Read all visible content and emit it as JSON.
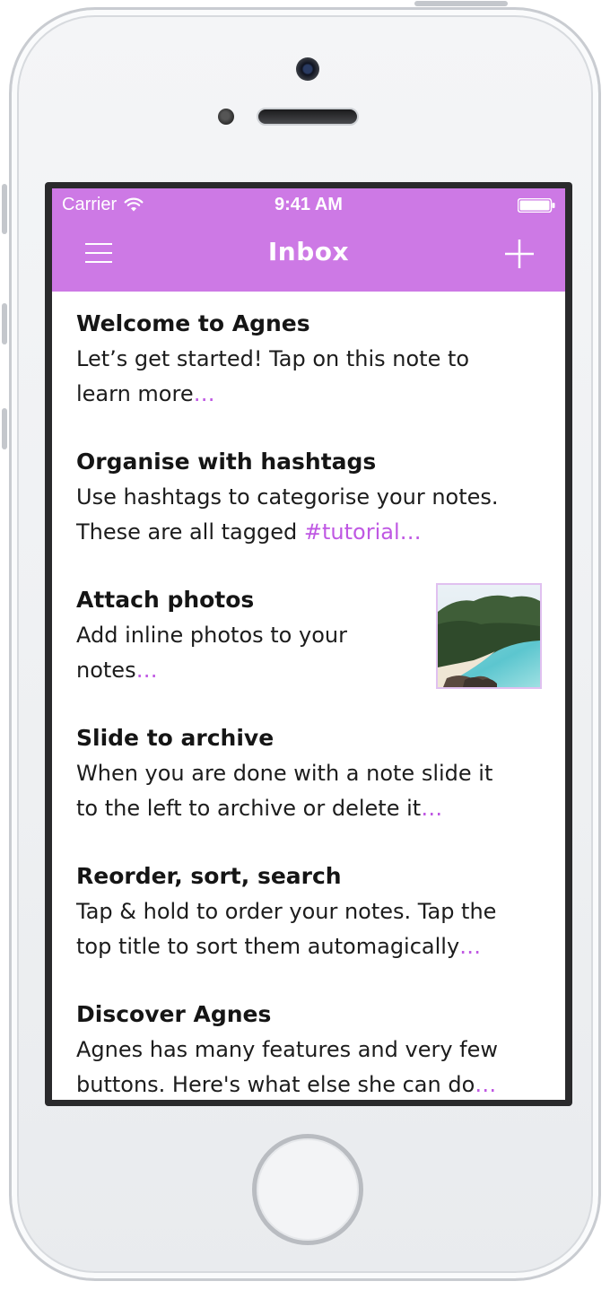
{
  "status_bar": {
    "carrier": "Carrier",
    "time": "9:41 AM"
  },
  "nav": {
    "title": "Inbox"
  },
  "colors": {
    "accent": "#cd79e5",
    "link": "#bf58e3",
    "text": "#1c1c1c"
  },
  "notes": [
    {
      "title": "Welcome to Agnes",
      "lines": [
        "Let’s get started! Tap on this note to",
        "learn more"
      ],
      "tag": "",
      "ellipsis": "…"
    },
    {
      "title": "Organise with hashtags",
      "lines": [
        "Use hashtags to categorise your notes.",
        "These are all tagged "
      ],
      "tag": "#tutorial",
      "ellipsis": "…"
    },
    {
      "title": "Attach photos",
      "lines": [
        "Add inline photos to your",
        "notes"
      ],
      "tag": "",
      "ellipsis": "…"
    },
    {
      "title": "Slide to archive",
      "lines": [
        "When you are done with a note slide it",
        "to the left to archive or delete it"
      ],
      "tag": "",
      "ellipsis": "…"
    },
    {
      "title": "Reorder, sort, search",
      "lines": [
        "Tap & hold to order your notes. Tap the",
        "top title to sort them automagically"
      ],
      "tag": "",
      "ellipsis": "…"
    },
    {
      "title": "Discover Agnes",
      "lines": [
        "Agnes has many features and very few",
        "buttons. Here's what else she can do"
      ],
      "tag": "",
      "ellipsis": "…"
    }
  ]
}
